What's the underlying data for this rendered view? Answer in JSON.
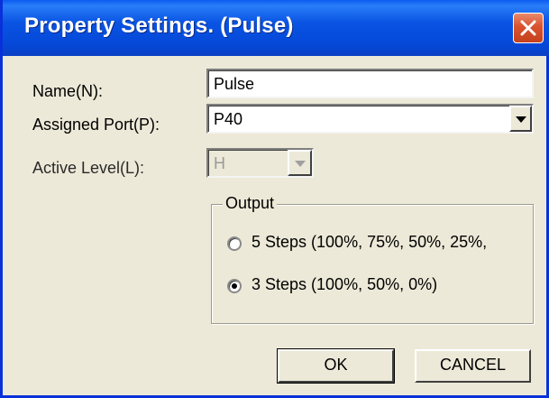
{
  "window": {
    "title": "Property Settings. (Pulse)",
    "close_icon": "close-x-icon"
  },
  "form": {
    "name_label": "Name(N):",
    "name_value": "Pulse",
    "port_label": "Assigned Port(P):",
    "port_value": "P40",
    "level_label": "Active Level(L):",
    "level_value": "H"
  },
  "output": {
    "legend": "Output",
    "options": [
      {
        "label": "5 Steps (100%, 75%, 50%, 25%,",
        "selected": false
      },
      {
        "label": "3 Steps (100%, 50%, 0%)",
        "selected": true
      }
    ]
  },
  "buttons": {
    "ok": "OK",
    "cancel": "CANCEL"
  },
  "colors": {
    "titlebar": "#0a54e3",
    "close": "#d9532e",
    "dialog_bg": "#ece9d8"
  }
}
